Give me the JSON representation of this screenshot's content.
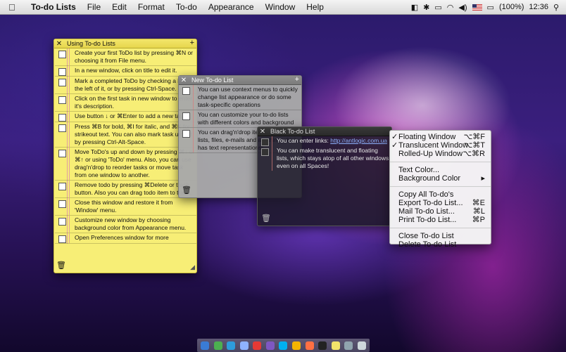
{
  "menubar": {
    "app_name": "To-do Lists",
    "menus": [
      "File",
      "Edit",
      "Format",
      "To-do",
      "Appearance",
      "Window",
      "Help"
    ],
    "battery": "(100%)",
    "clock": "12:36",
    "icons": [
      "apple-icon",
      "wifi-icon",
      "volume-icon",
      "flag-icon",
      "battery-icon",
      "spotlight-icon"
    ]
  },
  "window1": {
    "title": "Using To-do Lists",
    "items": [
      "Create your first ToDo list by pressing ⌘N or choosing it from File menu.",
      "In a new window, click on title to edit it.",
      "Mark a completed ToDo by checking a box to the left of it, or by pressing Ctrl-Space.",
      "Click on the first task in new window to enter it's description.",
      "Use button ↓ or ⌘Enter to add a new task.",
      "Press ⌘B for bold, ⌘I for italic, and ⌘K for strikeout text. You can also mark task urgent by pressing Ctrl-Alt-Space.",
      "Move ToDo's up and down by pressing ⌘↓ or ⌘↑ or using 'ToDo' menu. Also, you can use drag'n'drop to reorder tasks or move task from one window to another.",
      "Remove todo by pressing ⌘Delete or trash button. Also you can drag todo item to trash.",
      "Close this window and restore it from 'Window' menu.",
      "Customize new window by choosing background color from Appearance menu.",
      "Open Preferences window for more"
    ]
  },
  "window2": {
    "title": "New To-do List",
    "items": [
      "You can use context menus to quickly change list appearance or do some task-specific operations",
      "You can customize your to-do lists with different colors and background",
      "You can drag'n'drop items between lists, files, e-mails and anything which has text representations!"
    ]
  },
  "window3": {
    "title": "Black To-do List",
    "link_prefix": "You can enter links: ",
    "link_text": "http://antlogic.com.ua",
    "items": [
      "You can make translucent and floating lists, which stays atop of all other windows even on all Spaces!"
    ]
  },
  "context_menu": {
    "groups": [
      [
        {
          "label": "Floating Window",
          "checked": true,
          "shortcut": "⌥⌘F"
        },
        {
          "label": "Translucent Window",
          "checked": true,
          "shortcut": "⌥⌘T"
        },
        {
          "label": "Rolled-Up Window",
          "checked": false,
          "shortcut": "⌥⌘R"
        }
      ],
      [
        {
          "label": "Text Color...",
          "checked": false,
          "shortcut": ""
        },
        {
          "label": "Background Color",
          "checked": false,
          "shortcut": "▸"
        }
      ],
      [
        {
          "label": "Copy All To-do's",
          "checked": false,
          "shortcut": ""
        },
        {
          "label": "Export To-do List...",
          "checked": false,
          "shortcut": "⌘E"
        },
        {
          "label": "Mail To-do List...",
          "checked": false,
          "shortcut": "⌘L"
        },
        {
          "label": "Print To-do List...",
          "checked": false,
          "shortcut": "⌘P"
        }
      ],
      [
        {
          "label": "Close To-do List",
          "checked": false,
          "shortcut": ""
        },
        {
          "label": "Delete To-do List",
          "checked": false,
          "shortcut": ""
        }
      ]
    ]
  },
  "dock": {
    "icons": [
      "finder-icon",
      "dashboard-icon",
      "safari-icon",
      "mail-icon",
      "ical-icon",
      "itunes-icon",
      "skype-icon",
      "iphoto-icon",
      "app-icon",
      "terminal-icon",
      "notes-icon",
      "preview-icon",
      "trash-icon"
    ],
    "colors": [
      "#3a7bd5",
      "#4caf50",
      "#2d9cdb",
      "#8fb3ff",
      "#e53935",
      "#7e57c2",
      "#00aff0",
      "#f4b400",
      "#ff7043",
      "#222222",
      "#f2e36a",
      "#90a4ae",
      "#cfd8dc"
    ]
  },
  "colors": {
    "sticky_yellow": "#f7ee76",
    "gray_window": "#a8a8a8",
    "black_window": "#1c1928"
  }
}
